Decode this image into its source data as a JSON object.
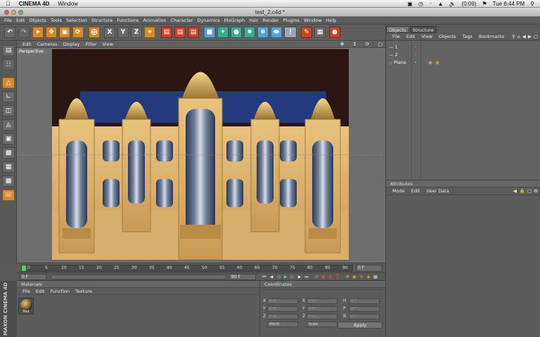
{
  "macmenu": {
    "app_name": "CINEMA 4D",
    "window_menu": "Window",
    "battery": "(0:09)",
    "clock": "Tue 6:44 PM"
  },
  "window": {
    "title": "test_2.c4d *"
  },
  "menubar": [
    "File",
    "Edit",
    "Objects",
    "Tools",
    "Selection",
    "Structure",
    "Functions",
    "Animation",
    "Character",
    "Dynamics",
    "MoGraph",
    "Hair",
    "Render",
    "Plugins",
    "Window",
    "Help"
  ],
  "viewport": {
    "menu": [
      "Edit",
      "Cameras",
      "Display",
      "Filter",
      "View"
    ],
    "label": "Perspective"
  },
  "timeline": {
    "ticks": [
      0,
      5,
      10,
      15,
      20,
      25,
      30,
      35,
      40,
      45,
      50,
      55,
      60,
      65,
      70,
      75,
      80,
      85,
      90
    ],
    "current_frame": "0 F",
    "start_field": "0 F",
    "end_field": "90 F"
  },
  "materials": {
    "header": "Materials",
    "menu": [
      "File",
      "Edit",
      "Function",
      "Texture"
    ],
    "items": [
      {
        "name": "Mat"
      }
    ]
  },
  "brand": "MAXON CINEMA 4D",
  "coordinates": {
    "header": "Coordinates",
    "col1": [
      "X",
      "Y",
      "Z"
    ],
    "col2": [
      "X",
      "Y",
      "Z"
    ],
    "col3": [
      "H",
      "P",
      "B"
    ],
    "value": "0 m",
    "angle": "0 °",
    "mode_select": "World",
    "scale_select": "Scale",
    "apply": "Apply"
  },
  "objects_panel": {
    "tabs": [
      "Objects",
      "Structure"
    ],
    "menu": [
      "File",
      "Edit",
      "View",
      "Objects",
      "Tags",
      "Bookmarks"
    ],
    "items": [
      {
        "name": "1"
      },
      {
        "name": "2"
      },
      {
        "name": "Plane"
      }
    ]
  },
  "attributes": {
    "header": "Attributes",
    "menu": [
      "Mode",
      "Edit",
      "User Data"
    ]
  }
}
